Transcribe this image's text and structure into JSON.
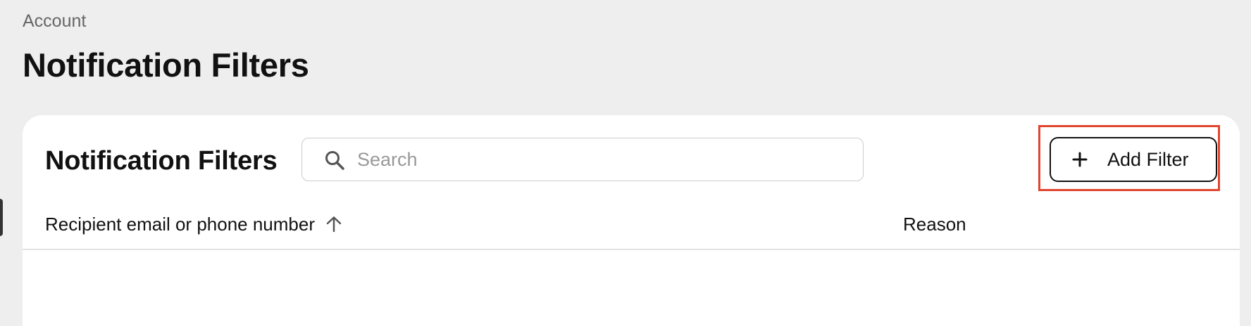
{
  "breadcrumb": "Account",
  "page_title": "Notification Filters",
  "card": {
    "title": "Notification Filters",
    "search": {
      "placeholder": "Search",
      "value": "",
      "icon": "search-icon"
    },
    "add_filter_button": {
      "label": "Add Filter",
      "icon": "plus-icon"
    }
  },
  "table": {
    "columns": [
      {
        "label": "Recipient email or phone number",
        "sort": "ascending",
        "sort_icon": "arrow-up-icon"
      },
      {
        "label": "Reason"
      }
    ],
    "rows": []
  },
  "colors": {
    "page_background": "#eeeeee",
    "card_background": "#ffffff",
    "highlight": "#e0452e",
    "text": "#111111",
    "muted_text": "#666666"
  }
}
